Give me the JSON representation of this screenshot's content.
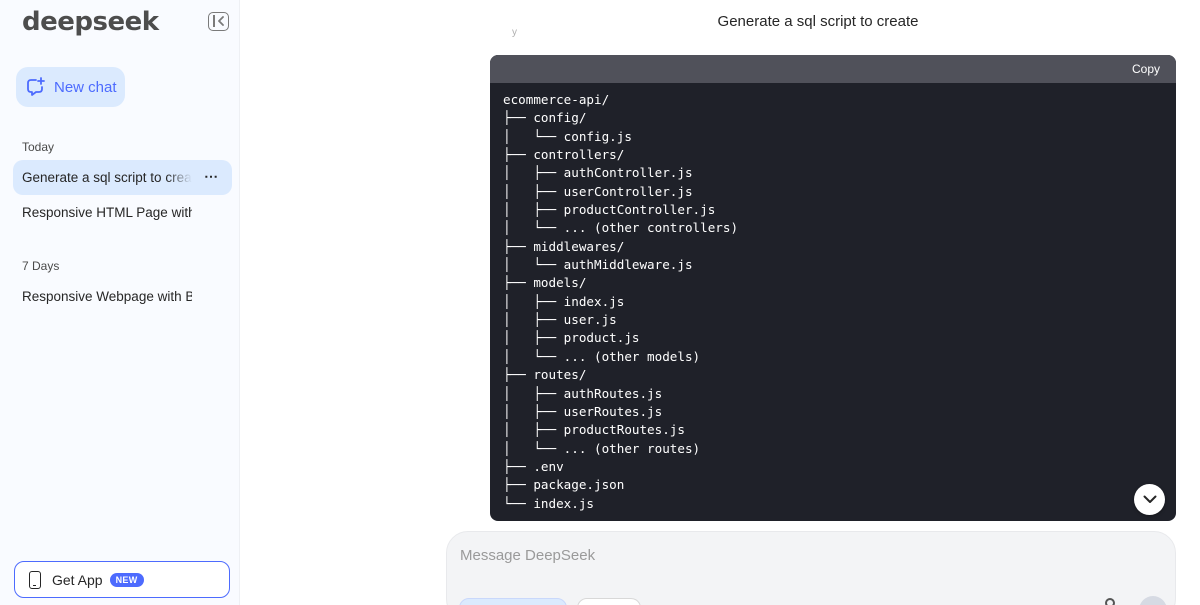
{
  "sidebar": {
    "logo": "deepseek",
    "new_chat_label": "New chat",
    "sections": [
      {
        "label": "Today",
        "items": [
          {
            "label": "Generate a sql script to create",
            "active": true
          },
          {
            "label": "Responsive HTML Page with Bootstrap",
            "active": false
          }
        ]
      },
      {
        "label": "7 Days",
        "items": [
          {
            "label": "Responsive Webpage with Bootstrap",
            "active": false
          }
        ]
      }
    ],
    "more_icon": "⋯",
    "get_app": {
      "label": "Get App",
      "badge": "NEW"
    }
  },
  "main": {
    "title": "Generate a sql script to create",
    "code": {
      "copy_label": "Copy",
      "lines": [
        "ecommerce-api/",
        "├── config/",
        "│   └── config.js",
        "├── controllers/",
        "│   ├── authController.js",
        "│   ├── userController.js",
        "│   ├── productController.js",
        "│   └── ... (other controllers)",
        "├── middlewares/",
        "│   └── authMiddleware.js",
        "├── models/",
        "│   ├── index.js",
        "│   ├── user.js",
        "│   ├── product.js",
        "│   └── ... (other models)",
        "├── routes/",
        "│   ├── authRoutes.js",
        "│   ├── userRoutes.js",
        "│   ├── productRoutes.js",
        "│   └── ... (other routes)",
        "├── .env",
        "├── package.json",
        "└── index.js"
      ]
    },
    "composer": {
      "placeholder": "Message DeepSeek"
    }
  },
  "colors": {
    "accent": "#4d6bfe",
    "sidebar_bg": "#f9fbff",
    "active_bg": "#dbeafe",
    "code_bg": "#1f2129",
    "code_header_bg": "#50515a"
  },
  "icons": {
    "collapse": "sidebar-collapse-icon",
    "new_chat": "chat-plus-icon",
    "more": "more-dots-icon",
    "phone": "phone-icon",
    "scroll_down": "chevron-down-icon"
  }
}
